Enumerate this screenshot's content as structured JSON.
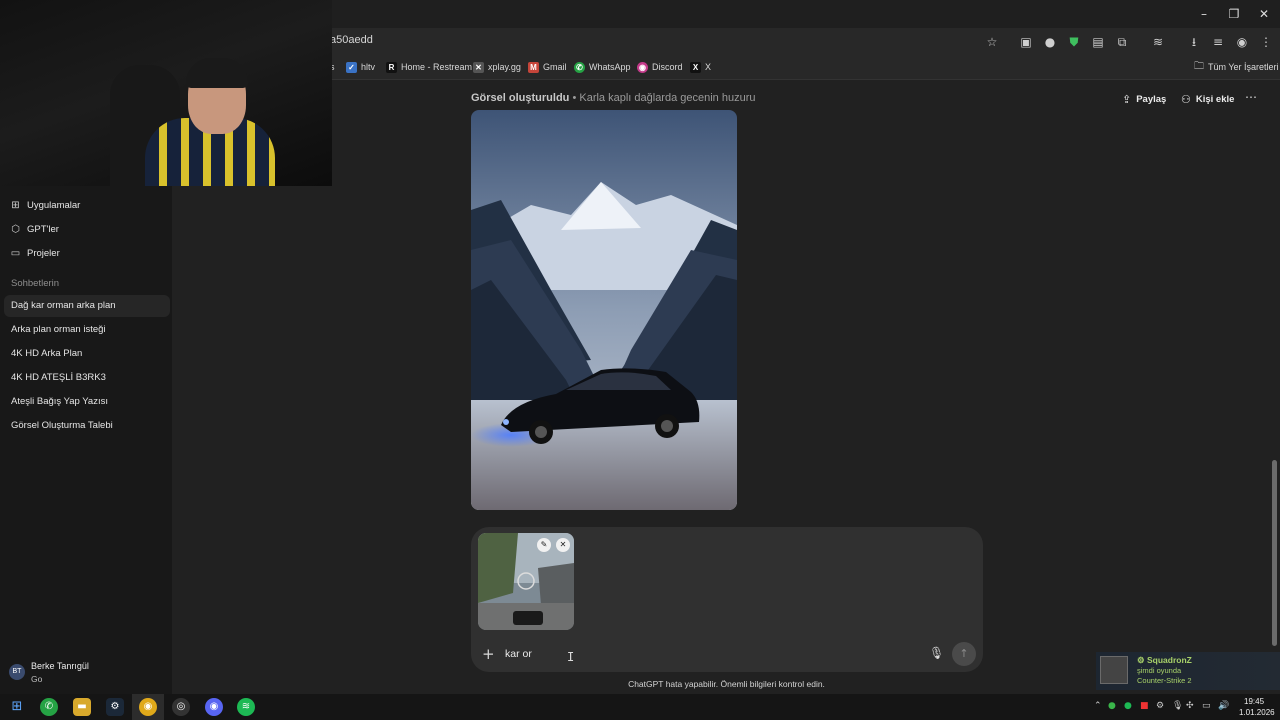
{
  "browser": {
    "url": "a50aedd",
    "bookmarks": [
      {
        "label": "s",
        "icon": ""
      },
      {
        "label": "hltv",
        "icon": "hltv-icon"
      },
      {
        "label": "Home - Restream",
        "icon": "restream-icon"
      },
      {
        "label": "xplay.gg",
        "icon": "xplay-icon"
      },
      {
        "label": "Gmail",
        "icon": "gmail-icon"
      },
      {
        "label": "WhatsApp",
        "icon": "whatsapp-icon"
      },
      {
        "label": "Discord",
        "icon": "discord-icon"
      },
      {
        "label": "X",
        "icon": "x-icon"
      }
    ],
    "all_bookmarks": "Tüm Yer İşaretleri"
  },
  "sidebar": {
    "nav": [
      {
        "label": "Uygulamalar",
        "icon": "apps-grid-icon"
      },
      {
        "label": "GPT'ler",
        "icon": "gpts-cube-icon"
      },
      {
        "label": "Projeler",
        "icon": "folder-icon"
      }
    ],
    "section_title": "Sohbetlerin",
    "chats": [
      "Dağ kar orman arka plan",
      "Arka plan orman isteği",
      "4K HD Arka Plan",
      "4K HD ATEŞLİ B3RK3",
      "Ateşli Bağış Yap Yazısı",
      "Görsel Oluşturma Talebi"
    ],
    "user": {
      "initials": "BT",
      "name": "Berke Tanrıgül",
      "plan": "Go"
    }
  },
  "header": {
    "status": "Görsel oluşturuldu",
    "title": " • Karla kaplı dağlarda gecenin huzuru",
    "share_label": "Paylaş",
    "add_person_label": "Kişi ekle"
  },
  "composer": {
    "input_value": "kar or",
    "disclaimer": "ChatGPT hata yapabilir. Önemli bilgileri kontrol edin."
  },
  "notification": {
    "name": "SquadronZ",
    "status": "şimdi oyunda",
    "game": "Counter-Strike 2"
  },
  "taskbar": {
    "time": "19:45",
    "date": "1.01.2026"
  },
  "colors": {
    "background": "#212121",
    "sidebar": "#181818",
    "composer": "#303030",
    "steam_green": "#a8d169"
  }
}
